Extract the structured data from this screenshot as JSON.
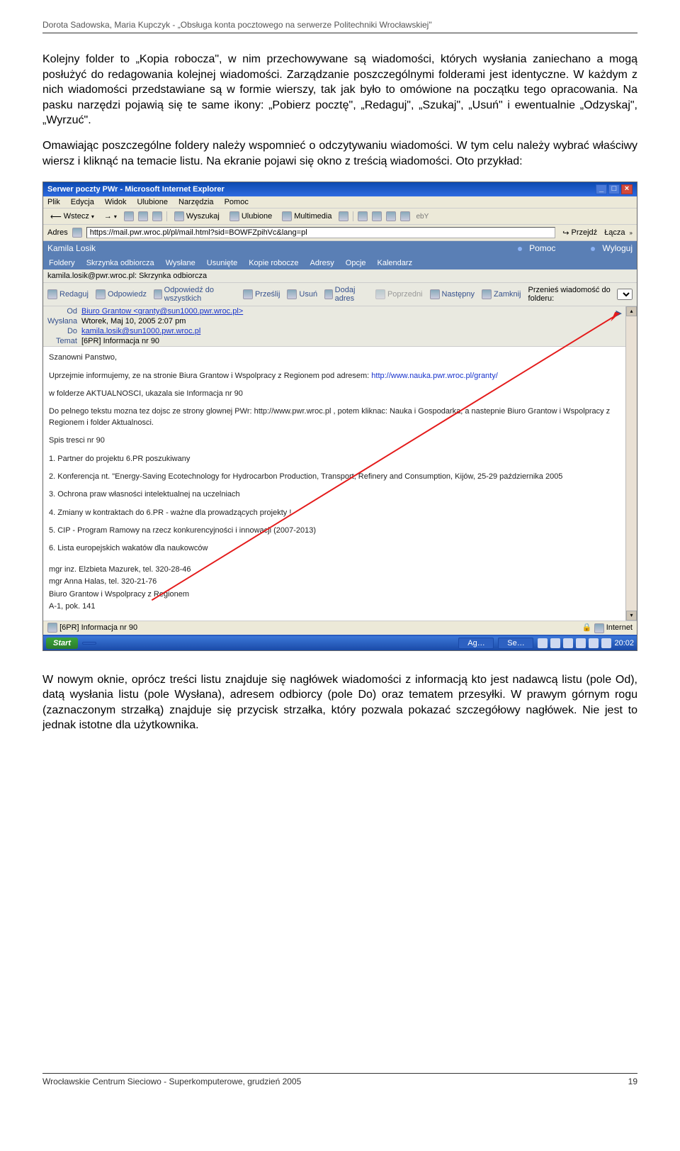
{
  "doc": {
    "header": "Dorota Sadowska, Maria Kupczyk - „Obsługa konta pocztowego na serwerze Politechniki Wrocławskiej\"",
    "para1": "Kolejny folder to „Kopia robocza\", w nim przechowywane są wiadomości, których wysłania zaniechano a mogą posłużyć do redagowania kolejnej wiadomości. Zarządzanie poszczególnymi folderami jest identyczne. W każdym z nich wiadomości przedstawiane są w formie wierszy, tak jak było to omówione na początku tego opracowania. Na pasku narzędzi pojawią się te same ikony: „Pobierz pocztę\", „Redaguj\", „Szukaj\", „Usuń\" i ewentualnie „Odzyskaj\", „Wyrzuć\".",
    "para2": "Omawiając poszczególne foldery należy wspomnieć o odczytywaniu wiadomości. W tym celu należy wybrać właściwy wiersz i kliknąć na temacie listu. Na ekranie pojawi się okno z treścią wiadomości. Oto przykład:",
    "para3": "W nowym oknie, oprócz treści listu znajduje się nagłówek wiadomości z informacją kto jest nadawcą listu (pole Od), datą wysłania listu (pole Wysłana), adresem odbiorcy (pole Do) oraz tematem przesyłki. W prawym górnym rogu (zaznaczonym strzałką) znajduje się przycisk strzałka, który pozwala pokazać szczegółowy nagłówek. Nie jest to jednak istotne dla użytkownika.",
    "footer_left": "Wrocławskie Centrum Sieciowo - Superkomputerowe, grudzień 2005",
    "footer_right": "19"
  },
  "ie": {
    "title": "Serwer poczty PWr - Microsoft Internet Explorer",
    "menu": [
      "Plik",
      "Edycja",
      "Widok",
      "Ulubione",
      "Narzędzia",
      "Pomoc"
    ],
    "toolbar": {
      "back": "Wstecz",
      "search": "Wyszukaj",
      "favorites": "Ulubione",
      "media": "Multimedia"
    },
    "address_label": "Adres",
    "url": "https://mail.pwr.wroc.pl/pl/mail.html?sid=BOWFZpihVc&lang=pl",
    "go": "Przejdź",
    "links": "Łącza",
    "status_left": "[6PR] Informacja nr 90",
    "status_right": "Internet"
  },
  "mail": {
    "user": "Kamila Losik",
    "help": "Pomoc",
    "logout": "Wyloguj",
    "tabs": [
      "Foldery",
      "Skrzynka odbiorcza",
      "Wysłane",
      "Usunięte",
      "Kopie robocze",
      "Adresy",
      "Opcje",
      "Kalendarz"
    ],
    "breadcrumb": "kamila.losik@pwr.wroc.pl: Skrzynka odbiorcza",
    "toolbar": {
      "redaguj": "Redaguj",
      "odpowiedz": "Odpowiedz",
      "odpowiedz_all": "Odpowiedź do wszystkich",
      "przeslij": "Prześlij",
      "usun": "Usuń",
      "dodaj_adres": "Dodaj adres",
      "poprzedni": "Poprzedni",
      "nastepny": "Następny",
      "zamknij": "Zamknij",
      "move": "Przenieś wiadomość do folderu:"
    },
    "headers": {
      "od_lbl": "Od",
      "od_val": "Biuro Grantow <granty@sun1000.pwr.wroc.pl>",
      "wyslana_lbl": "Wysłana",
      "wyslana_val": "Wtorek, Maj 10, 2005 2:07 pm",
      "do_lbl": "Do",
      "do_val": "kamila.losik@sun1000.pwr.wroc.pl",
      "temat_lbl": "Temat",
      "temat_val": "[6PR] Informacja nr 90"
    },
    "body": {
      "p1": "Szanowni Panstwo,",
      "p2_a": "Uprzejmie informujemy, ze na stronie Biura Grantow i Wspolpracy z Regionem  pod adresem: ",
      "p2_link": "http://www.nauka.pwr.wroc.pl/granty/",
      "p3": "w folderze AKTUALNOSCI, ukazala sie Informacja nr 90",
      "p4": "Do pelnego tekstu mozna tez dojsc ze strony glownej PWr: http://www.pwr.wroc.pl , potem kliknac: Nauka i Gospodarka, a nastepnie Biuro Grantow i Wspolpracy z Regionem i folder Aktualnosci.",
      "p5": "Spis tresci nr 90",
      "li1": "1. Partner do projektu 6.PR poszukiwany",
      "li2": "2. Konferencja nt. \"Energy-Saving Ecotechnology for Hydrocarbon Production, Transport, Refinery and Consumption, Kijów, 25-29 października 2005",
      "li3": "3. Ochrona praw własności intelektualnej na uczelniach",
      "li4": "4. Zmiany w kontraktach do 6.PR - ważne dla prowadzących projekty !",
      "li5": "5. CIP - Program Ramowy na rzecz konkurencyjności i innowacji (2007-2013)",
      "li6": "6. Lista europejskich wakatów dla naukowców",
      "sig1": "mgr inz. Elzbieta Mazurek, tel. 320-28-46",
      "sig2": "mgr Anna Halas, tel. 320-21-76",
      "sig3": "Biuro Grantow i Wspolpracy z Regionem",
      "sig4": "A-1, pok. 141"
    }
  },
  "taskbar": {
    "start": "Start",
    "items": [
      "Ag…",
      "Se…"
    ],
    "time": "20:02"
  }
}
